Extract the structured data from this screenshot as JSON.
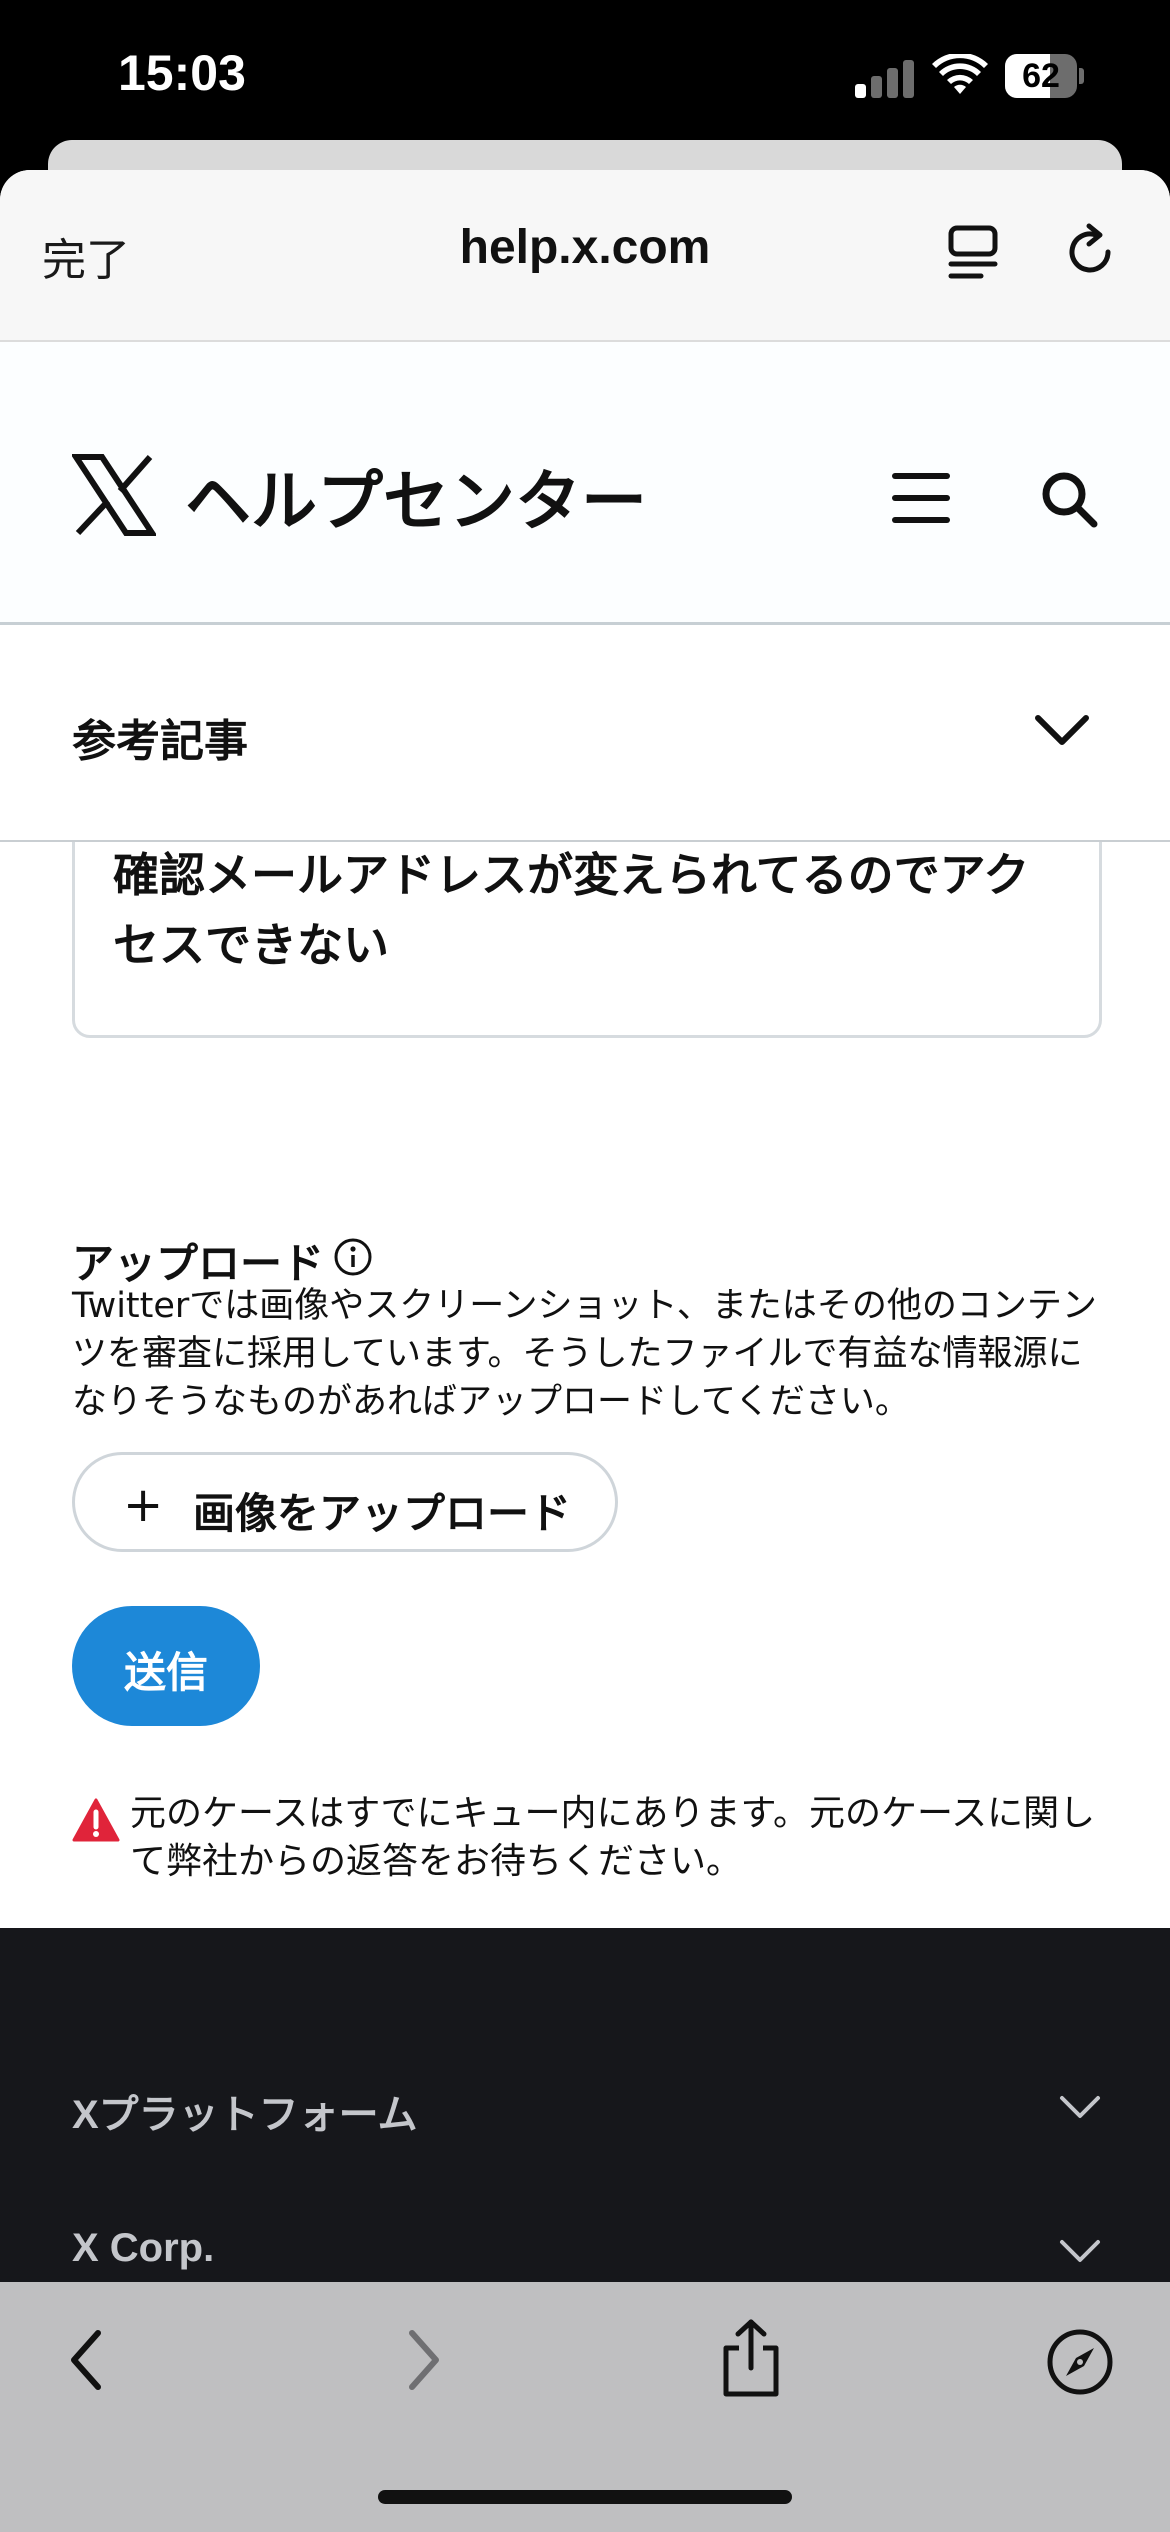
{
  "status_bar": {
    "time": "15:03",
    "battery": "62",
    "battery_level": 0.62
  },
  "browser": {
    "done_label": "完了",
    "url": "help.x.com",
    "reader_icon": "reader-icon",
    "reload_icon": "reload-icon"
  },
  "header": {
    "logo_icon": "x-logo",
    "title": "ヘルプセンター",
    "menu_icon": "hamburger-icon",
    "search_icon": "search-icon"
  },
  "related": {
    "label": "参考記事",
    "chevron_icon": "chevron-down-icon"
  },
  "form": {
    "selected_reason": "確認メールアドレスが変えられてるのでアクセスできない",
    "upload_title": "アップロード",
    "upload_desc": "Twitterでは画像やスクリーンショット、またはその他のコンテンツを審査に採用しています。そうしたファイルで有益な情報源になりそうなものがあればアップロードしてください。",
    "upload_button": "画像をアップロード",
    "send_button": "送信",
    "warning": "元のケースはすでにキュー内にあります。元のケースに関して弊社からの返答をお待ちください。",
    "accent_color": "#1d88d8",
    "warning_color": "#e0243a"
  },
  "footer": {
    "items": [
      "Xプラットフォーム",
      "X Corp."
    ]
  },
  "toolbar": {
    "icons": [
      "back-icon",
      "forward-icon",
      "share-icon",
      "compass-icon"
    ]
  }
}
